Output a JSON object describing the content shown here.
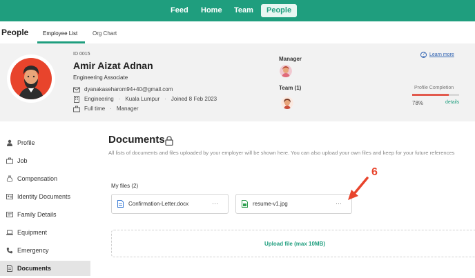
{
  "topnav": {
    "items": [
      {
        "label": "Feed"
      },
      {
        "label": "Home"
      },
      {
        "label": "Team"
      },
      {
        "label": "People",
        "active": true
      }
    ]
  },
  "subnav": {
    "title": "People",
    "tabs": [
      {
        "label": "Employee List",
        "active": true
      },
      {
        "label": "Org Chart"
      }
    ]
  },
  "employee": {
    "id": "ID 0015",
    "name": "Amir Aizat Adnan",
    "role": "Engineering Associate",
    "email": "dyanakaseharom94+40@gmail.com",
    "department": "Engineering",
    "location": "Kuala Lumpur",
    "joined": "Joined 8 Feb 2023",
    "employment_type": "Full time",
    "level": "Manager"
  },
  "manager": {
    "label": "Manager"
  },
  "team": {
    "label": "Team (1)"
  },
  "learn_more": "Learn more",
  "profile_completion": {
    "label": "Profile Completion",
    "percent_text": "78%",
    "value": 0.78,
    "details": "details"
  },
  "sidebar": {
    "items": [
      {
        "label": "Profile",
        "icon": "person-icon"
      },
      {
        "label": "Job",
        "icon": "briefcase-icon"
      },
      {
        "label": "Compensation",
        "icon": "money-bag-icon"
      },
      {
        "label": "Identity Documents",
        "icon": "id-card-icon"
      },
      {
        "label": "Family Details",
        "icon": "family-card-icon"
      },
      {
        "label": "Equipment",
        "icon": "laptop-icon"
      },
      {
        "label": "Emergency",
        "icon": "phone-icon"
      },
      {
        "label": "Documents",
        "icon": "document-icon",
        "active": true
      }
    ]
  },
  "documents": {
    "title": "Documents",
    "description": "All lists of documents and files uploaded by your employer will be shown here. You can also upload your own files and keep for your future references",
    "my_files_label": "My files (2)",
    "files": [
      {
        "name": "Confirmation-Letter.docx",
        "type": "docx",
        "icon_color": "#3a7bd5"
      },
      {
        "name": "resume-v1.jpg",
        "type": "jpg",
        "icon_color": "#2e9e4f"
      }
    ],
    "more": "···",
    "upload_label": "Upload file (max 10MB)"
  },
  "annotation": {
    "number": "6",
    "color": "#e8442c"
  },
  "colors": {
    "brand": "#1f9e7e",
    "progress": "#e25a4e",
    "link": "#2b5fb0"
  }
}
